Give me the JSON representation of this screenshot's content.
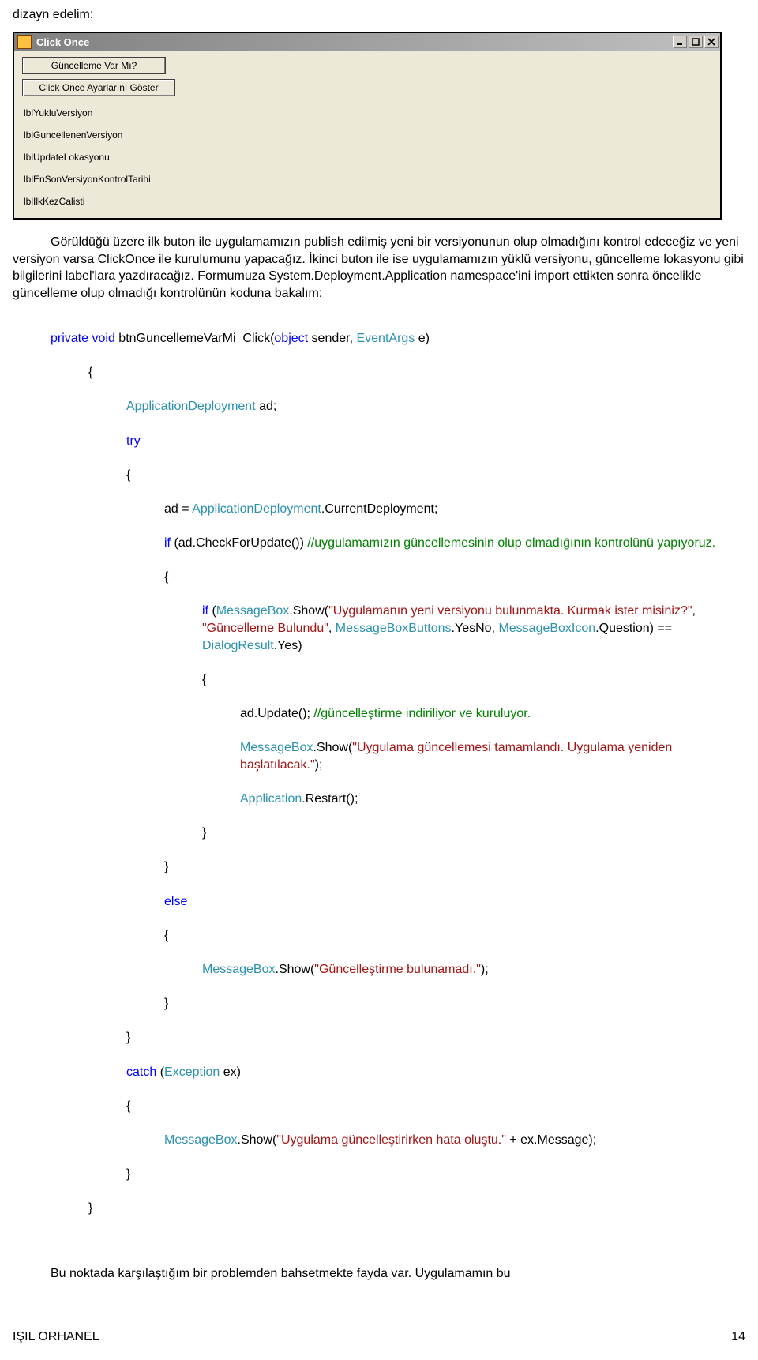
{
  "topText": "dizayn edelim:",
  "win": {
    "title": "Click Once",
    "btn1": "Güncelleme Var Mı?",
    "btn2": "Click Once Ayarlarını Göster",
    "lbl1": "lblYukluVersiyon",
    "lbl2": "lblGuncellenenVersiyon",
    "lbl3": "lblUpdateLokasyonu",
    "lbl4": "lblEnSonVersiyonKontrolTarihi",
    "lbl5": "lblIlkKezCalisti"
  },
  "para1": "Görüldüğü üzere ilk buton ile uygulamamızın publish edilmiş yeni bir versiyonunun olup olmadığını kontrol edeceğiz ve yeni versiyon varsa ClickOnce ile kurulumunu yapacağız. İkinci buton ile ise uygulamamızın yüklü versiyonu, güncelleme lokasyonu gibi bilgilerini label'lara yazdıracağız. Formumuza System.Deployment.Application namespace'ini import ettikten sonra  öncelikle güncelleme olup olmadığı kontrolünün koduna bakalım:",
  "code": {
    "kw_private": "private",
    "kw_void": "void",
    "kw_object": "object",
    "kw_try": "try",
    "kw_if": "if",
    "kw_else": "else",
    "kw_catch": "catch",
    "fn": "btnGuncellemeVarMi_Click(",
    "sender": " sender, ",
    "type_eventargs": "EventArgs",
    "args_e": " e)",
    "type_appdep": "ApplicationDeployment",
    "ad_decl": " ad;",
    "ad_assign": "ad = ",
    "dot_cur": ".CurrentDeployment;",
    "if_check": " (ad.CheckForUpdate()) ",
    "cmt_check": "//uygulamamızın güncellemesinin olup olmadığının kontrolünü yapıyoruz.",
    "if_msg": " (",
    "type_msgbox": "MessageBox",
    "show_txt": ".Show(",
    "str_yeni": "\"Uygulamanın yeni versiyonu bulunmakta. Kurmak ister misiniz?\"",
    "comma": ", ",
    "str_bulundu": "\"Güncelleme Bulundu\"",
    "type_mbb": "MessageBoxButtons",
    "dot_yesno": ".YesNo, ",
    "type_mbi": "MessageBoxIcon",
    "dot_question": ".Question) == ",
    "type_dialog": "DialogResult",
    "dot_yes": ".Yes)",
    "ad_update": "ad.Update(); ",
    "cmt_update": "//güncelleştirme indiriliyor ve kuruluyor.",
    "str_tamam": "\"Uygulama güncellemesi tamamlandı. Uygulama yeniden başlatılacak.\"",
    "paren_semi": ");",
    "type_app": "Application",
    "dot_restart": ".Restart();",
    "str_bulunamadi": "\"Güncelleştirme bulunamadı.\"",
    "catch_open": " (",
    "type_exc": "Exception",
    "ex_close": " ex)",
    "str_hata": "\"Uygulama güncelleştirirken hata oluştu.\"",
    "plus_ex": " + ex.Message);",
    "brace_open": "{",
    "brace_close": "}"
  },
  "para2": "Bu noktada karşılaştığım bir problemden bahsetmekte fayda var. Uygulamamın bu",
  "footer": {
    "author": "IŞIL ORHANEL",
    "page": "14"
  }
}
